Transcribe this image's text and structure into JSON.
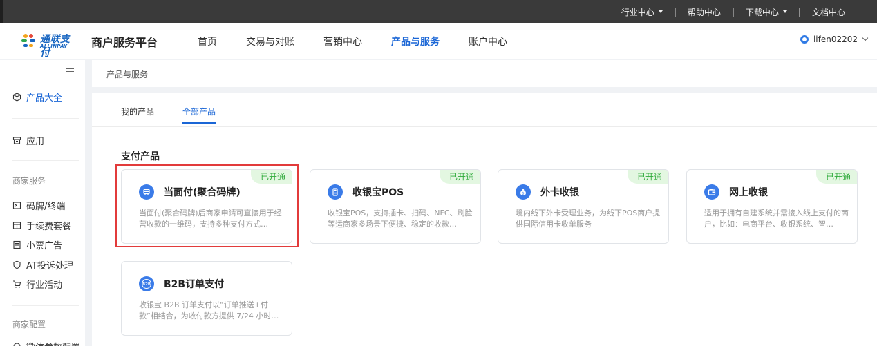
{
  "topbar": {
    "items": [
      {
        "label": "行业中心",
        "dropdown": true
      },
      {
        "label": "帮助中心",
        "dropdown": false
      },
      {
        "label": "下载中心",
        "dropdown": true
      },
      {
        "label": "文档中心",
        "dropdown": false
      }
    ],
    "separator": "|"
  },
  "header": {
    "logo_text": "通联支付",
    "logo_sub": "ALLINPAY",
    "platform_title": "商户服务平台",
    "nav": [
      {
        "label": "首页",
        "active": false
      },
      {
        "label": "交易与对账",
        "active": false
      },
      {
        "label": "营销中心",
        "active": false
      },
      {
        "label": "产品与服务",
        "active": true
      },
      {
        "label": "账户中心",
        "active": false
      }
    ],
    "username": "lifen02202"
  },
  "sidebar": {
    "product_all": "产品大全",
    "apps": "应用",
    "group_merchant_service": "商家服务",
    "items": [
      {
        "label": "码牌/终端",
        "icon": "terminal-icon"
      },
      {
        "label": "手续费套餐",
        "icon": "package-icon"
      },
      {
        "label": "小票广告",
        "icon": "receipt-icon"
      },
      {
        "label": "AT投诉处理",
        "icon": "shield-icon"
      },
      {
        "label": "行业活动",
        "icon": "cart-icon"
      }
    ],
    "group_merchant_config": "商家配置",
    "last_item": "微信参数配置"
  },
  "breadcrumb": "产品与服务",
  "tabs": [
    {
      "label": "我的产品",
      "active": false
    },
    {
      "label": "全部产品",
      "active": true
    }
  ],
  "section_title": "支付产品",
  "cards": [
    {
      "title": "当面付(聚合码牌)",
      "badge": "已开通",
      "desc": "当面付(聚合码牌)后商家申请可直接用于经营收款的一维码，支持多种支付方式…",
      "icon": "aggregate-code-icon"
    },
    {
      "title": "收银宝POS",
      "badge": "已开通",
      "desc": "收银宝POS，支持插卡、扫码、NFC、刷脸等运商家多场景下便捷、稳定的收款…",
      "icon": "pos-icon"
    },
    {
      "title": "外卡收银",
      "badge": "已开通",
      "desc": "境内线下外卡受理业务，为线下POS商户提供国际信用卡收单服务",
      "icon": "foreign-card-icon"
    },
    {
      "title": "网上收银",
      "badge": "已开通",
      "desc": "适用于拥有自建系统并需接入线上支付的商户，比如：电商平台、收银系统、智…",
      "icon": "wallet-icon"
    },
    {
      "title": "B2B订单支付",
      "badge": "",
      "desc": "收银宝 B2B 订单支付以“订单推送+付款”相结合，为收付款方提供 7/24 小时…",
      "icon": "b2b-icon"
    }
  ],
  "colors": {
    "accent": "#1a66d6",
    "badge_bg": "#e3f7e1",
    "badge_text": "#2eaa3a",
    "highlight": "#e23b3b",
    "topbar": "#3a3a3a"
  }
}
